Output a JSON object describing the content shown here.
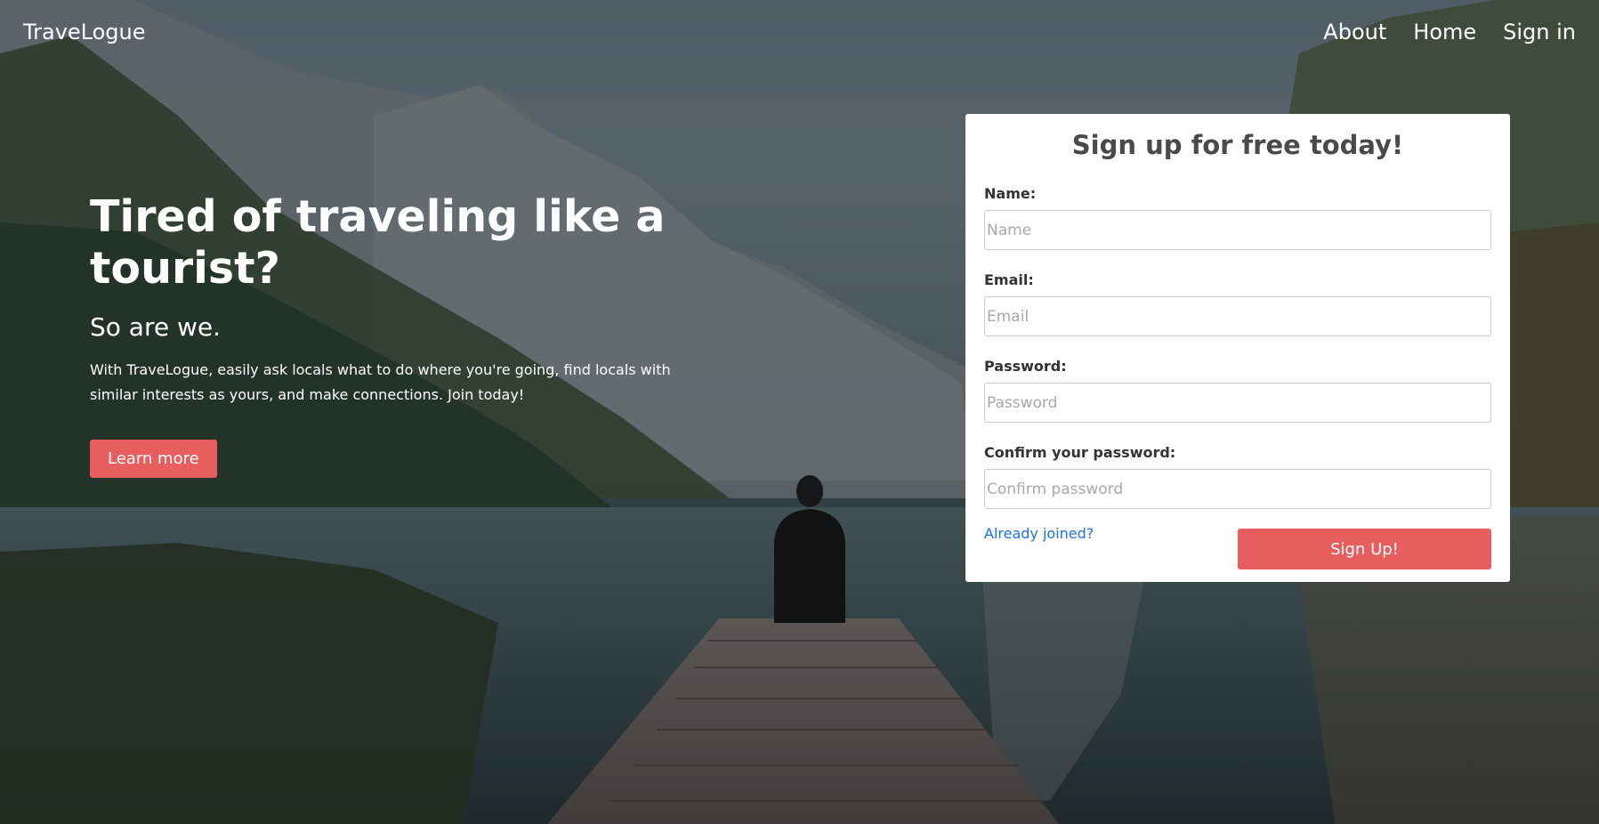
{
  "nav": {
    "brand": "TraveLogue",
    "links": [
      "About",
      "Home",
      "Sign in"
    ]
  },
  "hero": {
    "title": "Tired of traveling like a tourist?",
    "subtitle": "So are we.",
    "description": "With TraveLogue, easily ask locals what to do where you're going, find locals with similar interests as yours, and make connections. Join today!",
    "cta_label": "Learn more"
  },
  "form": {
    "title": "Sign up for free today!",
    "fields": [
      {
        "label": "Name:",
        "placeholder": "Name",
        "value": ""
      },
      {
        "label": "Email:",
        "placeholder": "Email",
        "value": ""
      },
      {
        "label": "Password:",
        "placeholder": "Password",
        "value": ""
      },
      {
        "label": "Confirm your password:",
        "placeholder": "Confirm password",
        "value": ""
      }
    ],
    "already_joined_label": "Already joined?",
    "submit_label": "Sign Up!"
  },
  "colors": {
    "accent": "#e85d5d",
    "link": "#1a73e8",
    "card_bg": "#ffffff"
  },
  "background": {
    "description_icon": "mountain-lake-photo"
  }
}
